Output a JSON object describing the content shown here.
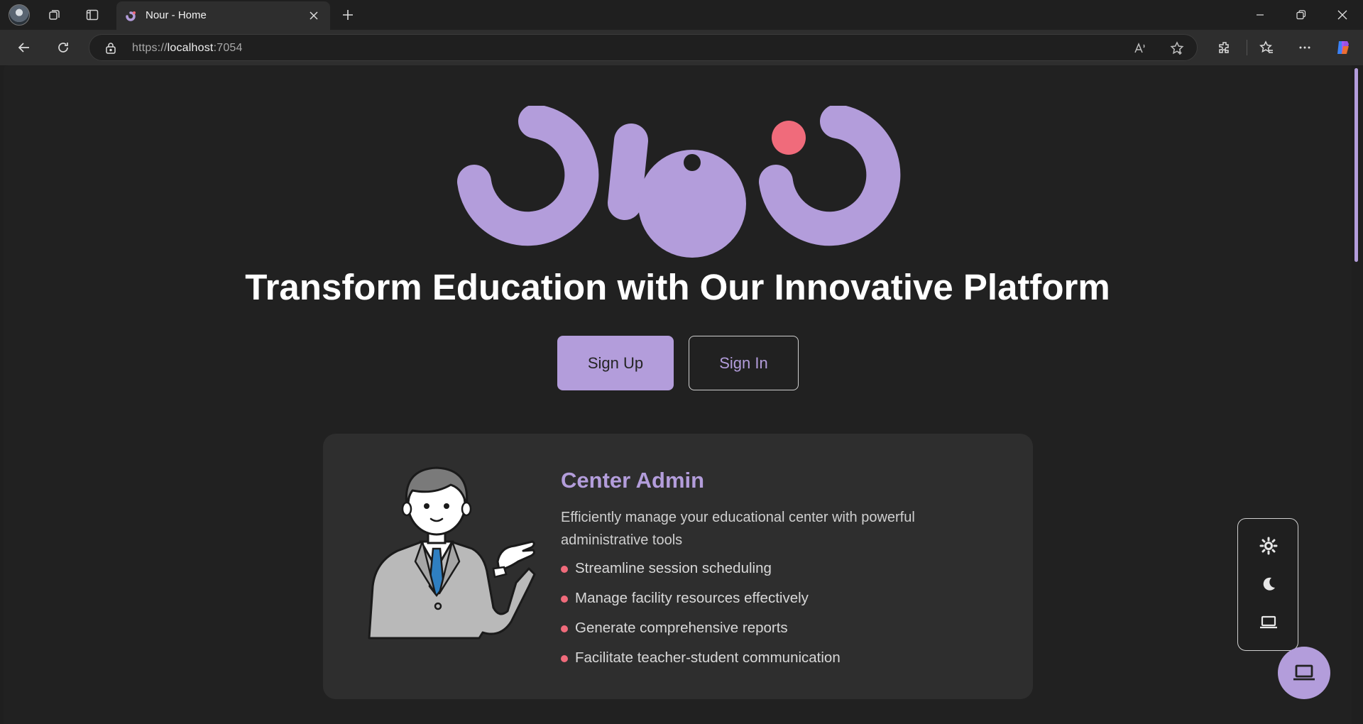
{
  "browser": {
    "tab_title": "Nour - Home",
    "url_scheme": "https://",
    "url_host": "localhost",
    "url_port": ":7054"
  },
  "hero": {
    "title": "Transform Education with Our Innovative Platform",
    "signup_label": "Sign Up",
    "signin_label": "Sign In"
  },
  "card": {
    "title": "Center Admin",
    "description": "Efficiently manage your educational center with powerful administrative tools",
    "features": [
      "Streamline session scheduling",
      "Manage facility resources effectively",
      "Generate comprehensive reports",
      "Facilitate teacher-student communication"
    ]
  },
  "colors": {
    "accent": "#b39ddb",
    "bullet": "#f06b7b",
    "logo_dot": "#f06b7b",
    "background": "#212121",
    "card": "#2e2e2e"
  },
  "icons": {
    "theme_light": "sun-icon",
    "theme_dark": "moon-icon",
    "theme_system": "laptop-icon",
    "fab": "laptop-icon"
  }
}
